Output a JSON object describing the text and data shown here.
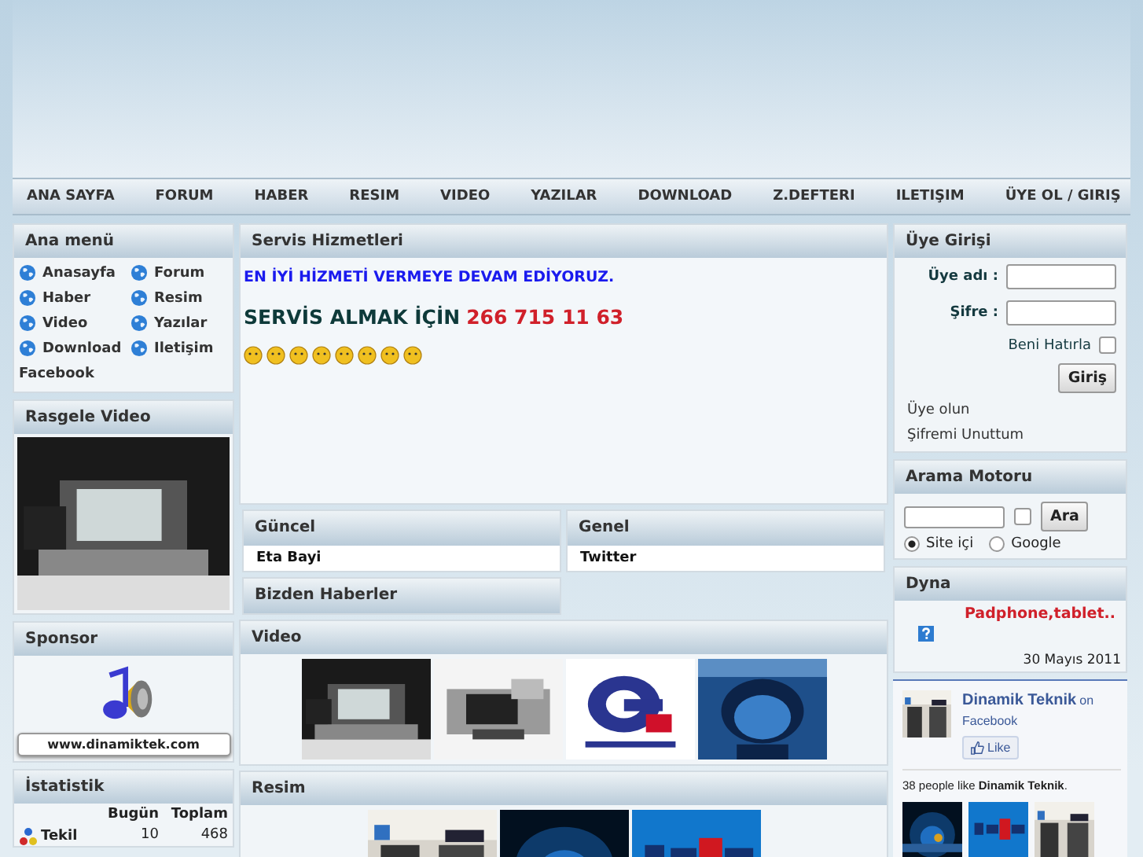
{
  "nav": [
    "ANA SAYFA",
    "FORUM",
    "HABER",
    "RESIM",
    "VIDEO",
    "YAZILAR",
    "DOWNLOAD",
    "Z.DEFTERI",
    "ILETIŞIM",
    "ÜYE OL / GIRIŞ"
  ],
  "menu": {
    "title": "Ana menü",
    "items": [
      "Anasayfa",
      "Forum",
      "Haber",
      "Resim",
      "Video",
      "Yazılar",
      "Download",
      "Iletişim"
    ],
    "extra": "Facebook"
  },
  "random_video": {
    "title": "Rasgele Video"
  },
  "sponsor": {
    "title": "Sponsor",
    "banner": "www.dinamiktek.com"
  },
  "stats": {
    "title": "İstatistik",
    "columns": [
      "Bugün",
      "Toplam"
    ],
    "rows": [
      {
        "label": "Tekil",
        "today": "10",
        "total": "468"
      }
    ]
  },
  "service": {
    "title": "Servis Hizmetleri",
    "slogan": "EN İYİ HİZMETİ VERMEYE DEVAM EDİYORUZ.",
    "call": "SERVİS ALMAK İÇİN",
    "phone": "266 715 11 63"
  },
  "blocks": [
    {
      "title": "Güncel",
      "items": [
        "Eta Bayi"
      ]
    },
    {
      "title": "Genel",
      "items": [
        "Twitter"
      ]
    },
    {
      "title": "Bizden Haberler"
    }
  ],
  "video": {
    "title": "Video"
  },
  "images": {
    "title": "Resim"
  },
  "login": {
    "title": "Üye Girişi",
    "user_label": "Üye adı :",
    "pass_label": "Şifre :",
    "remember": "Beni Hatırla",
    "remember_checked": false,
    "button": "Giriş",
    "links": [
      "Üye olun",
      "Şifremi Unuttum"
    ]
  },
  "search": {
    "title": "Arama Motoru",
    "button": "Ara",
    "checked": false,
    "options": [
      {
        "label": "Site içi",
        "selected": true
      },
      {
        "label": "Google",
        "selected": false
      }
    ]
  },
  "dyna": {
    "title": "Dyna",
    "headline": "Padphone,tablet..",
    "date": "30 Mayıs 2011"
  },
  "facebook": {
    "page": "Dinamik Teknik",
    "on": "on",
    "site": "Facebook",
    "like": "Like",
    "count_text": "38 people like **Dinamik Teknik**."
  }
}
